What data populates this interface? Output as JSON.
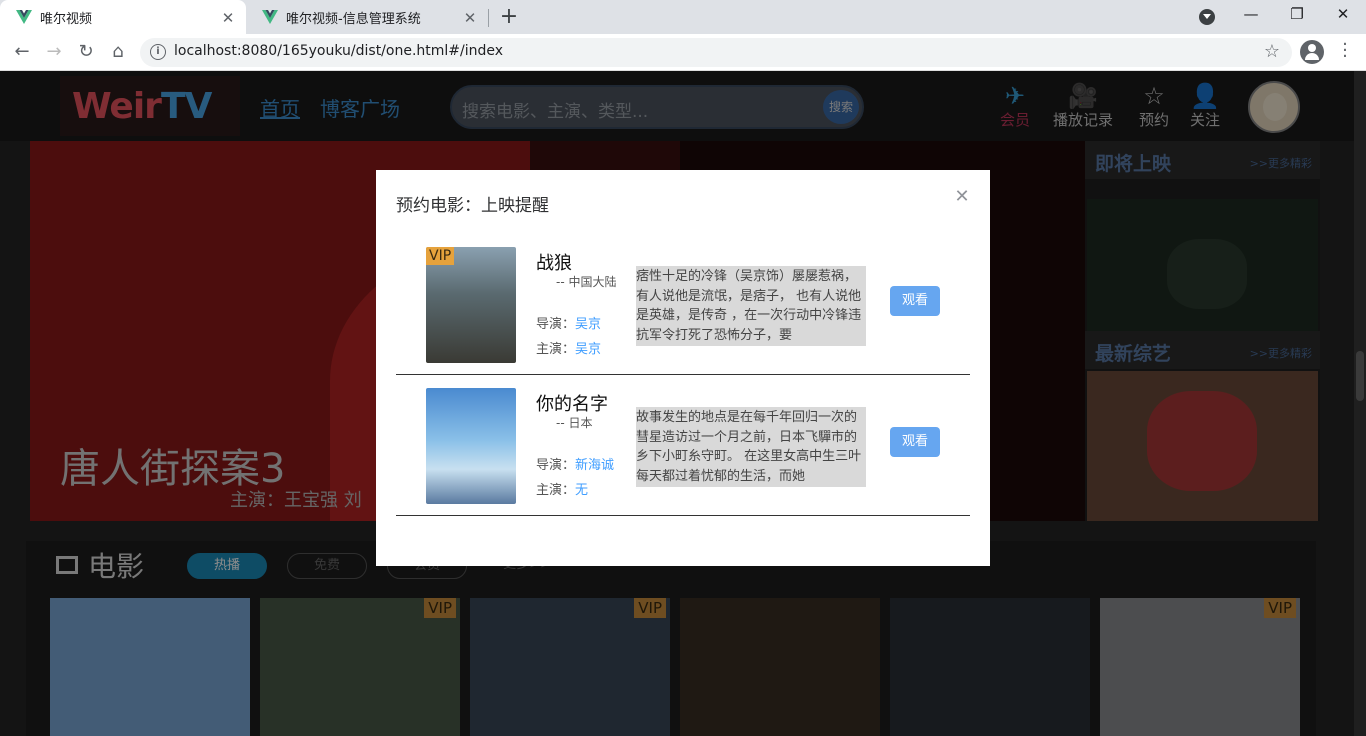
{
  "browser": {
    "tabs": [
      {
        "title": "唯尔视频"
      },
      {
        "title": "唯尔视频-信息管理系统"
      }
    ],
    "url": "localhost:8080/165youku/dist/one.html#/index"
  },
  "site": {
    "logo_text": "WeirTV",
    "nav": [
      "首页",
      "博客广场"
    ],
    "search_placeholder": "搜索电影、主演、类型...",
    "search_button": "搜索",
    "header_icons": [
      {
        "label": "会员",
        "icon": "paper-plane-icon",
        "color": "#c0365a"
      },
      {
        "label": "播放记录",
        "icon": "camera-icon"
      },
      {
        "label": "预约",
        "icon": "star-icon"
      },
      {
        "label": "关注",
        "icon": "person-icon"
      }
    ],
    "banner": {
      "title": "唐人街探案3",
      "subtitle": "主演：王宝强 刘"
    },
    "side": {
      "upcoming": "即将上映",
      "variety": "最新综艺",
      "more": ">>更多精彩"
    },
    "movies": {
      "title": "电影",
      "filters": [
        "热播",
        "免费",
        "会员",
        "更多>>"
      ],
      "vip_label": "VIP"
    }
  },
  "modal": {
    "title": "预约电影：上映提醒",
    "director_label": "导演：",
    "cast_label": "主演：",
    "watch_label": "观看",
    "items": [
      {
        "name": "战狼",
        "region": "-- 中国大陆",
        "director": "吴京",
        "cast": "吴京",
        "vip": "VIP",
        "description": "痞性十足的冷锋（吴京饰）屡屡惹祸，有人说他是流氓，是痞子， 也有人说他是英雄，是传奇 ，在一次行动中冷锋违抗军令打死了恐怖分子，要"
      },
      {
        "name": "你的名字",
        "region": "-- 日本",
        "director": "新海诚",
        "cast": "无",
        "vip": "",
        "description": "故事发生的地点是在每千年回归一次的彗星造访过一个月之前，日本飞驒市的乡下小町糸守町。 在这里女高中生三叶每天都过着忧郁的生活，而她"
      }
    ]
  }
}
